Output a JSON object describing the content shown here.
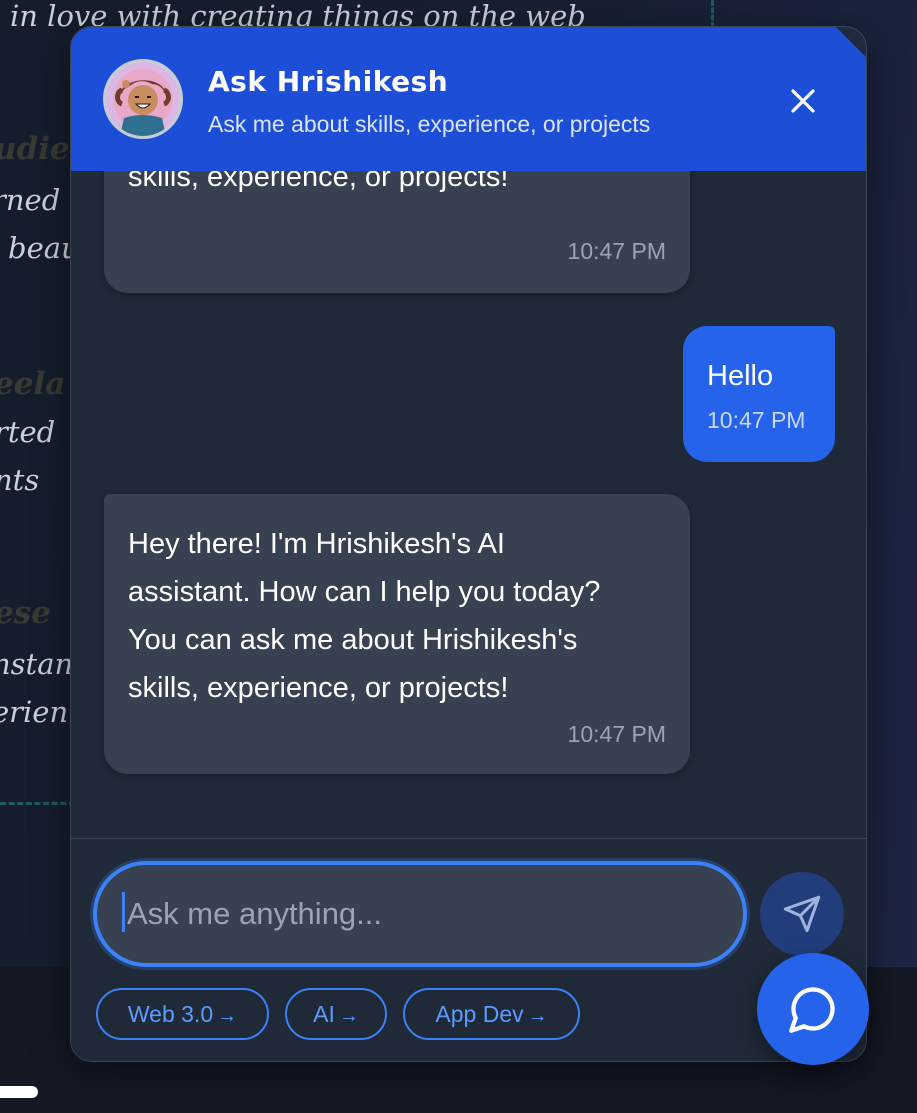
{
  "background": {
    "lines": [
      "in love with creating things on the web",
      "udie",
      "rned",
      "beau",
      "eela",
      "rted",
      "nts",
      "ese",
      "nstan",
      "erien"
    ]
  },
  "chat": {
    "title": "Ask Hrishikesh",
    "subtitle": "Ask me about skills, experience, or projects",
    "messages": [
      {
        "role": "bot",
        "lines": [
          "skills, experience, or projects!"
        ],
        "time": "10:47 PM"
      },
      {
        "role": "user",
        "lines": [
          "Hello"
        ],
        "time": "10:47 PM"
      },
      {
        "role": "bot",
        "lines": [
          "Hey there! I'm Hrishikesh's AI",
          "assistant. How can I help you today?",
          "You can ask me about Hrishikesh's",
          "skills, experience, or projects!"
        ],
        "time": "10:47 PM"
      }
    ],
    "input": {
      "value": "",
      "placeholder": "Ask me anything..."
    },
    "chips": [
      {
        "label": "Web 3.0",
        "arrow": "→"
      },
      {
        "label": "AI",
        "arrow": "→"
      },
      {
        "label": "App Dev",
        "arrow": "→"
      }
    ]
  },
  "icons": {
    "close": "close-icon",
    "send": "send-icon",
    "chat_bubble": "chat-bubble-icon",
    "avatar": "avatar-illustration"
  },
  "colors": {
    "header": "#1d4ed8",
    "panel": "#1f2937",
    "bot_bubble": "#374151",
    "user_bubble": "#2563eb",
    "accent": "#3b82f6"
  }
}
